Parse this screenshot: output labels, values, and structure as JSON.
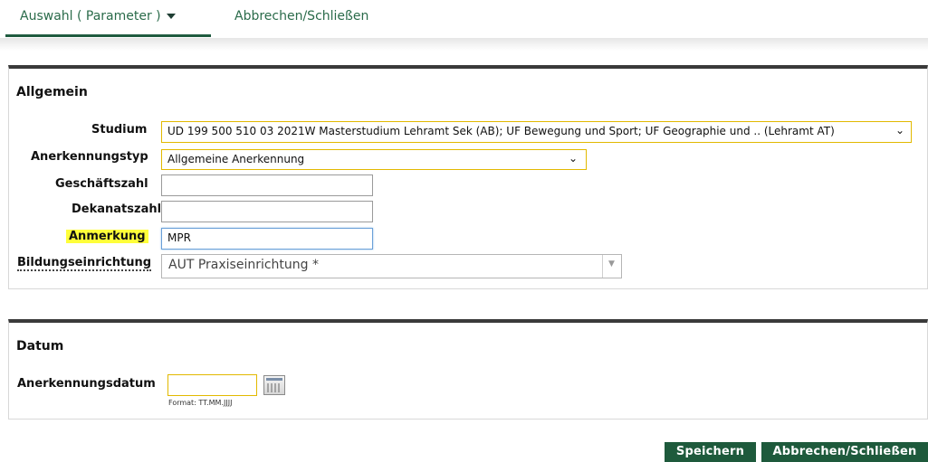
{
  "nav": {
    "tab_auswahl": "Auswahl ( Parameter )",
    "tab_abbrechen": "Abbrechen/Schließen"
  },
  "allgemein": {
    "title": "Allgemein",
    "studium_label": "Studium",
    "studium_value": "UD 199 500 510 03 2021W Masterstudium Lehramt Sek (AB); UF Bewegung und Sport; UF Geographie und .. (Lehramt AT)",
    "anerkennungstyp_label": "Anerkennungstyp",
    "anerkennungstyp_value": "Allgemeine Anerkennung",
    "geschaeftszahl_label": "Geschäftszahl",
    "geschaeftszahl_value": "",
    "dekanatszahl_label": "Dekanatszahl",
    "dekanatszahl_value": "",
    "anmerkung_label": "Anmerkung",
    "anmerkung_value": "MPR",
    "bildung_label": "Bildungseinrichtung",
    "bildung_value": "AUT Praxiseinrichtung *"
  },
  "datum": {
    "title": "Datum",
    "anerkennungsdatum_label": "Anerkennungsdatum",
    "anerkennungsdatum_value": "",
    "format_hint": "Format: TT.MM.JJJJ"
  },
  "actions": {
    "save": "Speichern",
    "cancel": "Abbrechen/Schließen"
  },
  "colors": {
    "accent_green": "#1e5a3c",
    "highlight": "#ffff3a",
    "select_border": "#e2b900"
  }
}
